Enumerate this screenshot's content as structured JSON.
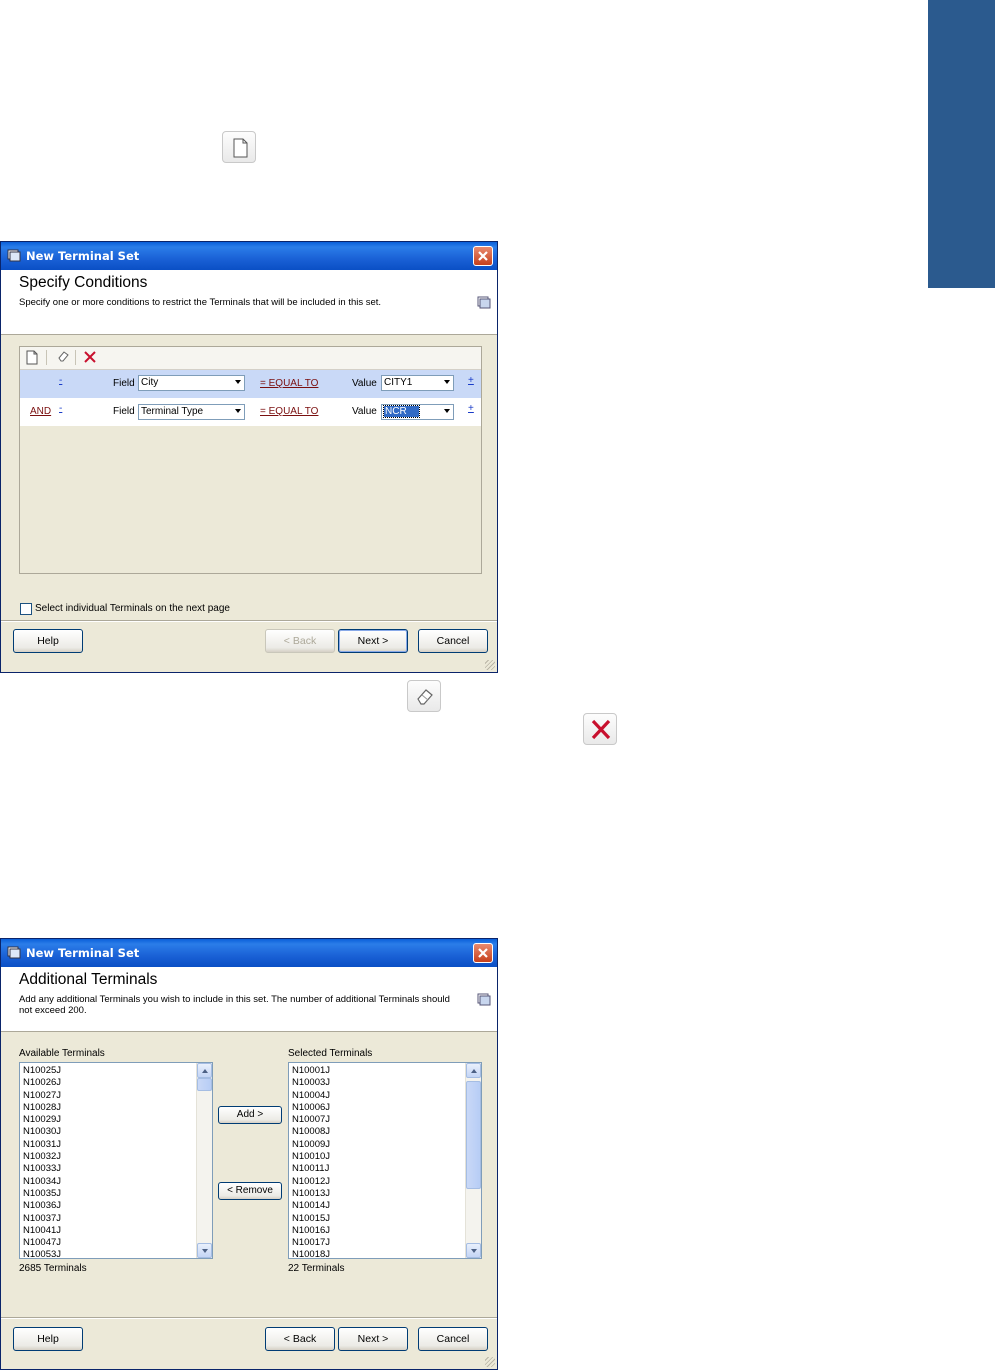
{
  "icons": {
    "new_doc": "new-document-icon",
    "eraser": "eraser-icon",
    "delete": "delete-x-icon"
  },
  "colors": {
    "side_tab": "#2b5a8e",
    "titlebar": "#1a61d6",
    "selected_row": "#c9d9f7",
    "operator_link": "#7a0f0f"
  },
  "dialog1": {
    "title": "New Terminal Set",
    "header_title": "Specify Conditions",
    "header_desc": "Specify one or more conditions to restrict the Terminals that will be included in this set.",
    "conditions": [
      {
        "connector": "",
        "minus": "-",
        "field_label": "Field",
        "field_value": "City",
        "operator": "= EQUAL TO",
        "value_label": "Value",
        "value_value": "CITY1",
        "plus": "+"
      },
      {
        "connector": "AND",
        "minus": "-",
        "field_label": "Field",
        "field_value": "Terminal Type",
        "operator": "= EQUAL TO",
        "value_label": "Value",
        "value_value": "NCR",
        "plus": "+"
      }
    ],
    "checkbox_label": "Select individual Terminals on the next page",
    "checkbox_checked": false,
    "buttons": {
      "help": "Help",
      "back": "< Back",
      "next": "Next >",
      "cancel": "Cancel"
    }
  },
  "dialog2": {
    "title": "New Terminal Set",
    "header_title": "Additional Terminals",
    "header_desc": "Add any additional Terminals you wish to include in this set. The number of additional Terminals should not exceed 200.",
    "available_label": "Available Terminals",
    "available_items": [
      "N10025J",
      "N10026J",
      "N10027J",
      "N10028J",
      "N10029J",
      "N10030J",
      "N10031J",
      "N10032J",
      "N10033J",
      "N10034J",
      "N10035J",
      "N10036J",
      "N10037J",
      "N10041J",
      "N10047J",
      "N10053J"
    ],
    "available_count": "2685 Terminals",
    "selected_label": "Selected Terminals",
    "selected_items": [
      "N10001J",
      "N10003J",
      "N10004J",
      "N10006J",
      "N10007J",
      "N10008J",
      "N10009J",
      "N10010J",
      "N10011J",
      "N10012J",
      "N10013J",
      "N10014J",
      "N10015J",
      "N10016J",
      "N10017J",
      "N10018J"
    ],
    "selected_count": "22 Terminals",
    "add_label": "Add >",
    "remove_label": "< Remove",
    "buttons": {
      "help": "Help",
      "back": "< Back",
      "next": "Next >",
      "cancel": "Cancel"
    }
  }
}
